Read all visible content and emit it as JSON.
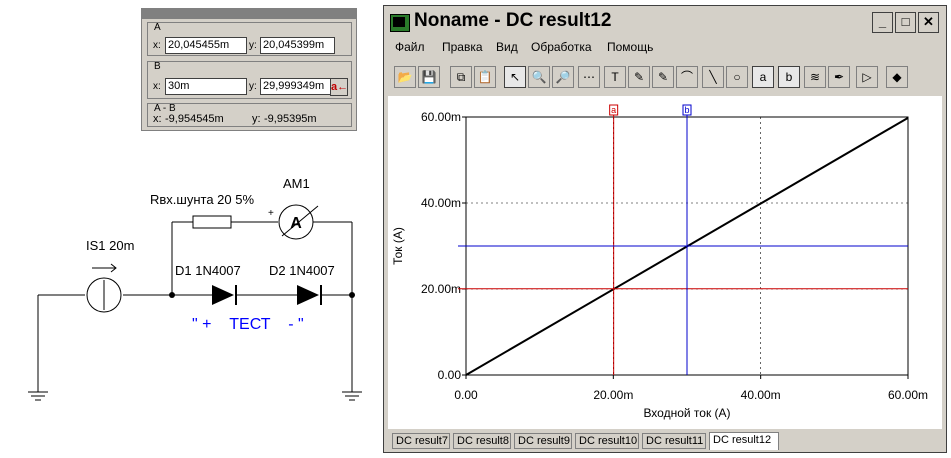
{
  "cursor_panel": {
    "a": {
      "title": "A",
      "x_label": "x:",
      "x_value": "20,045455m",
      "y_label": "y:",
      "y_value": "20,045399m"
    },
    "b": {
      "title": "B",
      "x_label": "x:",
      "x_value": "30m",
      "y_label": "y:",
      "y_value": "29,999349m",
      "button_label": "a←"
    },
    "diff": {
      "title": "A - B",
      "x_label": "x:",
      "x_value": "-9,954545m",
      "y_label": "y:",
      "y_value": "-9,95395m"
    }
  },
  "schematic": {
    "source_label": "IS1 20m",
    "shunt_label": "Rвх.шунта 20 5%",
    "ammeter_label": "AM1",
    "ammeter_symbol": "A",
    "plus_mark": "+",
    "d1_label": "D1 1N4007",
    "d2_label": "D2 1N4007",
    "caption": "\" +    ТЕСТ    - \""
  },
  "window": {
    "title": "Noname - DC result12",
    "buttons": {
      "minimize": "_",
      "maximize": "□",
      "close": "✕"
    },
    "menu": [
      "Файл",
      "Правка",
      "Вид",
      "Обработка",
      "Помощь"
    ],
    "toolbar_icons": [
      "open-icon",
      "save-icon",
      "copy-icon",
      "paste-icon",
      "pointer-icon",
      "zoom-in-icon",
      "zoom-fit-icon",
      "grid-icon",
      "text-icon",
      "pen-icon",
      "pen2-icon",
      "curve-icon",
      "line-icon",
      "circle-icon",
      "cursor-a-icon",
      "cursor-b-icon",
      "waveform-icon",
      "eyedropper-icon",
      "play-icon",
      "step-icon"
    ],
    "toolbar_glyphs": [
      "📂",
      "💾",
      "⧉",
      "📋",
      "↖",
      "🔍",
      "🔎",
      "⋯",
      "T",
      "✎",
      "✎",
      "⌒",
      "╲",
      "○",
      "a",
      "b",
      "≋",
      "✒",
      "▷",
      "◆"
    ],
    "tabs": [
      "DC result7",
      "DC result8",
      "DC result9",
      "DC result10",
      "DC result11",
      "DC result12"
    ],
    "active_tab": "DC result12"
  },
  "chart_data": {
    "type": "line",
    "xlabel": "Входной ток (A)",
    "ylabel": "Ток (A)",
    "x_ticks": [
      "0.00",
      "20.00m",
      "40.00m",
      "60.00m"
    ],
    "y_ticks": [
      "0.00",
      "20.00m",
      "40.00m",
      "60.00m"
    ],
    "xlim": [
      0,
      0.06
    ],
    "ylim": [
      0,
      0.06
    ],
    "series": [
      {
        "x": [
          0,
          0.06
        ],
        "y": [
          0,
          0.0598
        ],
        "color": "#000000"
      }
    ],
    "cursors": [
      {
        "name": "a",
        "x": 0.020045,
        "y": 0.020045,
        "color": "#cc0000"
      },
      {
        "name": "b",
        "x": 0.03,
        "y": 0.029999,
        "color": "#0000cc"
      }
    ],
    "grid": true
  }
}
